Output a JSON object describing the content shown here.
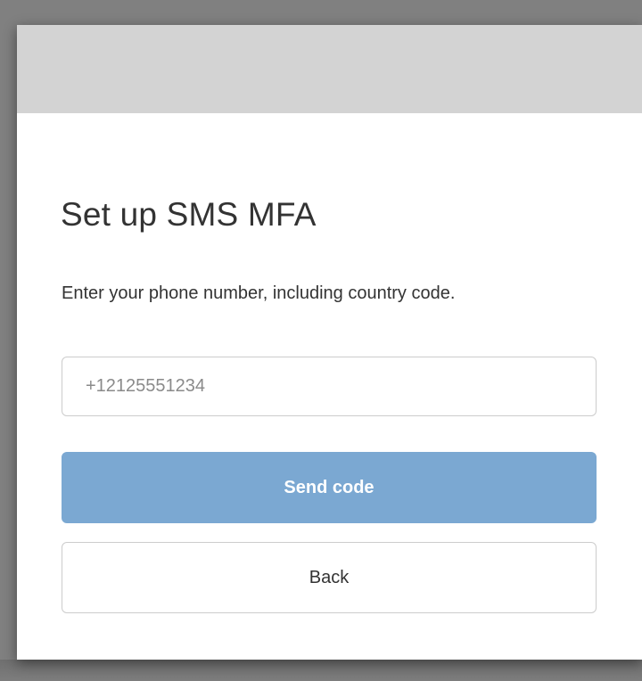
{
  "dialog": {
    "title": "Set up SMS MFA",
    "instructions": "Enter your phone number, including country code.",
    "phone_input": {
      "placeholder": "+12125551234",
      "value": ""
    },
    "send_code_label": "Send code",
    "back_label": "Back"
  },
  "colors": {
    "backdrop": "#808080",
    "header": "#d3d3d3",
    "primary_button": "#7ba8d2",
    "text": "#333333"
  }
}
